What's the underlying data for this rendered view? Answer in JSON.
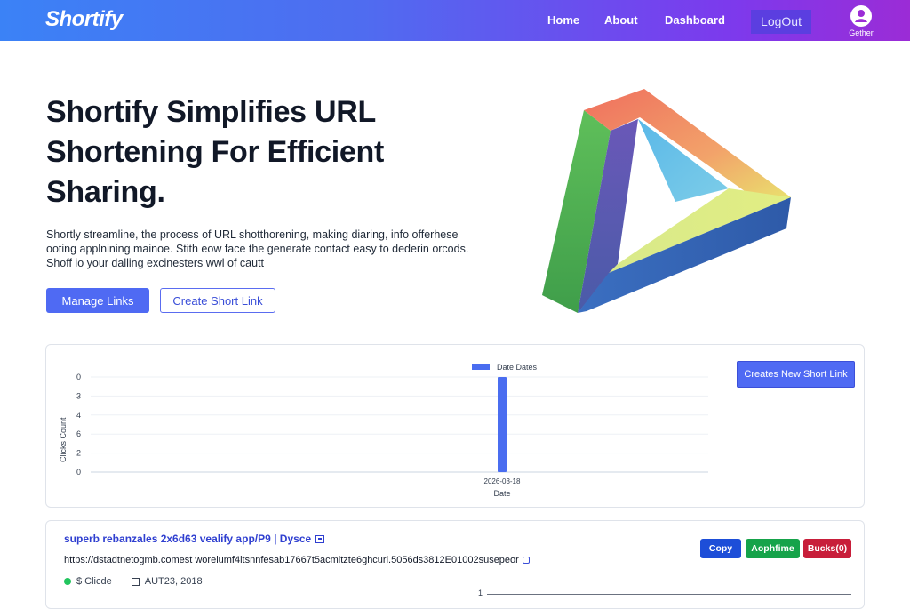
{
  "nav": {
    "brand": "Shortify",
    "links": [
      "Home",
      "About",
      "Dashboard"
    ],
    "logout": "LogOut",
    "user_name": "Gether"
  },
  "hero": {
    "title": "Shortify Simplifies URL Shortening For Efficient Sharing.",
    "description": "Shortly streamline, the process of URL shotthorening, making diaring, info offerhese ooting applnining mainoe. Stith eow face the generate contact easy to dederin orcods. Shoff io your dalling excinesters wwl of cautt",
    "primary_button": "Manage Links",
    "secondary_button": "Create Short Link"
  },
  "chart_card": {
    "create_button": "Creates New Short Link"
  },
  "chart_data": {
    "type": "bar",
    "legend": "Date Dates",
    "legend_position": "top-center",
    "ylabel": "Clicks Count",
    "xlabel": "Date",
    "categories": [
      "2026-03-18"
    ],
    "values": [
      10
    ],
    "yticks": [
      "0",
      "3",
      "4",
      "6",
      "2",
      "0"
    ],
    "ylim": [
      0,
      10
    ],
    "grid": true
  },
  "link_card": {
    "title": "superb rebanzales 2x6d63 vealify app/P9 | Dysce",
    "url": "https://dstadtnetogmb.comest worelumf4ltsnnfesab17667t5acmitzte6ghcurl.5056ds3812E01002susepeor",
    "status": "$ Clicde",
    "date": "AUT23, 2018",
    "buttons": {
      "copy": "Copy",
      "green": "Aophfime",
      "red": "Bucks(0)"
    },
    "mini_tick": "1"
  },
  "colors": {
    "nav_gradient_start": "#3b82f6",
    "nav_gradient_end": "#9b2cd6",
    "primary": "#4f6af3",
    "bar": "#4a6df0",
    "success": "#16a34a",
    "danger": "#c81e3a"
  }
}
